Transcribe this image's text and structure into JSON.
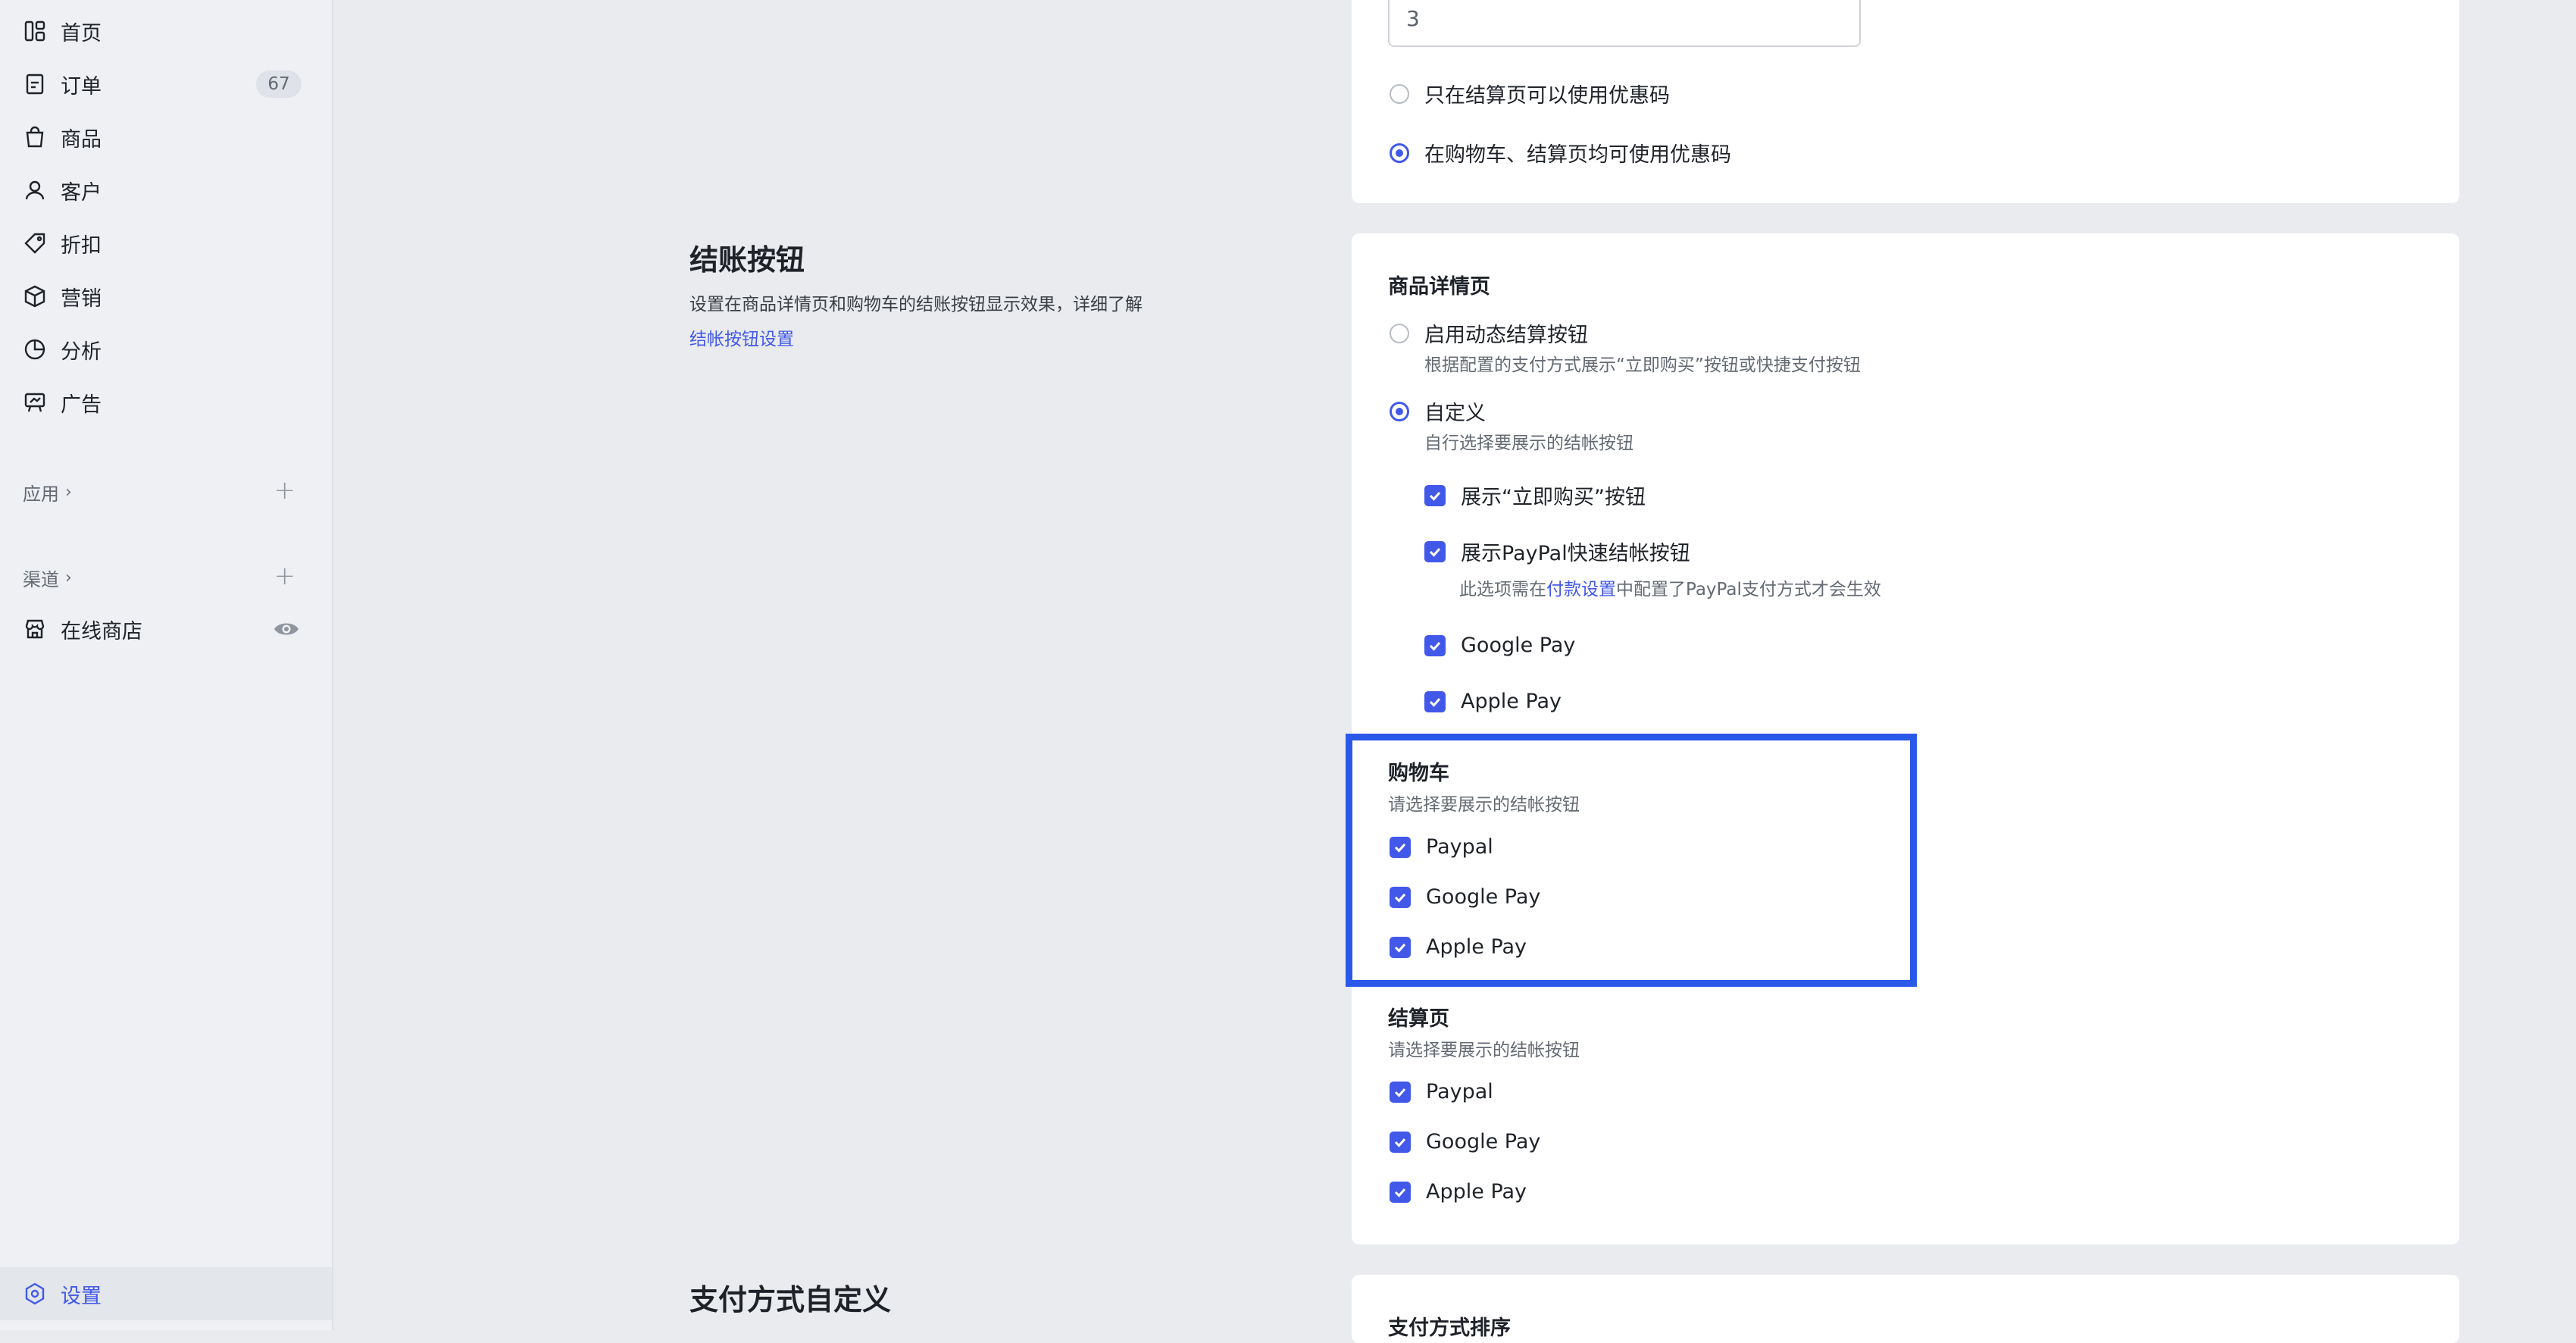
{
  "sidebar": {
    "items": [
      {
        "label": "首页",
        "icon": "dashboard-icon"
      },
      {
        "label": "订单",
        "icon": "order-icon",
        "badge": "67"
      },
      {
        "label": "商品",
        "icon": "shopping-bag-icon"
      },
      {
        "label": "客户",
        "icon": "user-icon"
      },
      {
        "label": "折扣",
        "icon": "tag-icon"
      },
      {
        "label": "营销",
        "icon": "cube-icon"
      },
      {
        "label": "分析",
        "icon": "pie-chart-icon"
      },
      {
        "label": "广告",
        "icon": "billboard-icon"
      }
    ],
    "apps_label": "应用",
    "channels_label": "渠道",
    "online_store_label": "在线商店",
    "settings_label": "设置"
  },
  "top_card": {
    "input_value": "3",
    "option_checkout_only": "只在结算页可以使用优惠码",
    "option_cart_and_checkout": "在购物车、结算页均可使用优惠码"
  },
  "checkout_section": {
    "title": "结账按钮",
    "desc": "设置在商品详情页和购物车的结账按钮显示效果，详细了解",
    "link": "结帐按钮设置"
  },
  "checkout_card": {
    "product_page_title": "商品详情页",
    "dynamic_label": "启用动态结算按钮",
    "dynamic_desc": "根据配置的支付方式展示“立即购买”按钮或快捷支付按钮",
    "custom_label": "自定义",
    "custom_desc": "自行选择要展示的结帐按钮",
    "show_buy_now": "展示“立即购买”按钮",
    "show_paypal": "展示PayPal快速结帐按钮",
    "paypal_note_pre": "此选项需在",
    "paypal_note_link": "付款设置",
    "paypal_note_post": "中配置了PayPal支付方式才会生效",
    "google_pay": "Google Pay",
    "apple_pay": "Apple Pay",
    "cart_title": "购物车",
    "cart_desc": "请选择要展示的结帐按钮",
    "cart_paypal": "Paypal",
    "cart_google": "Google Pay",
    "cart_apple": "Apple Pay",
    "checkout_title": "结算页",
    "checkout_desc": "请选择要展示的结帐按钮",
    "checkout_paypal": "Paypal",
    "checkout_google": "Google Pay",
    "checkout_apple": "Apple Pay"
  },
  "payment_section": {
    "title": "支付方式自定义",
    "card_title": "支付方式排序"
  },
  "colors": {
    "accent": "#4258e9",
    "highlight": "#2a58e8"
  }
}
